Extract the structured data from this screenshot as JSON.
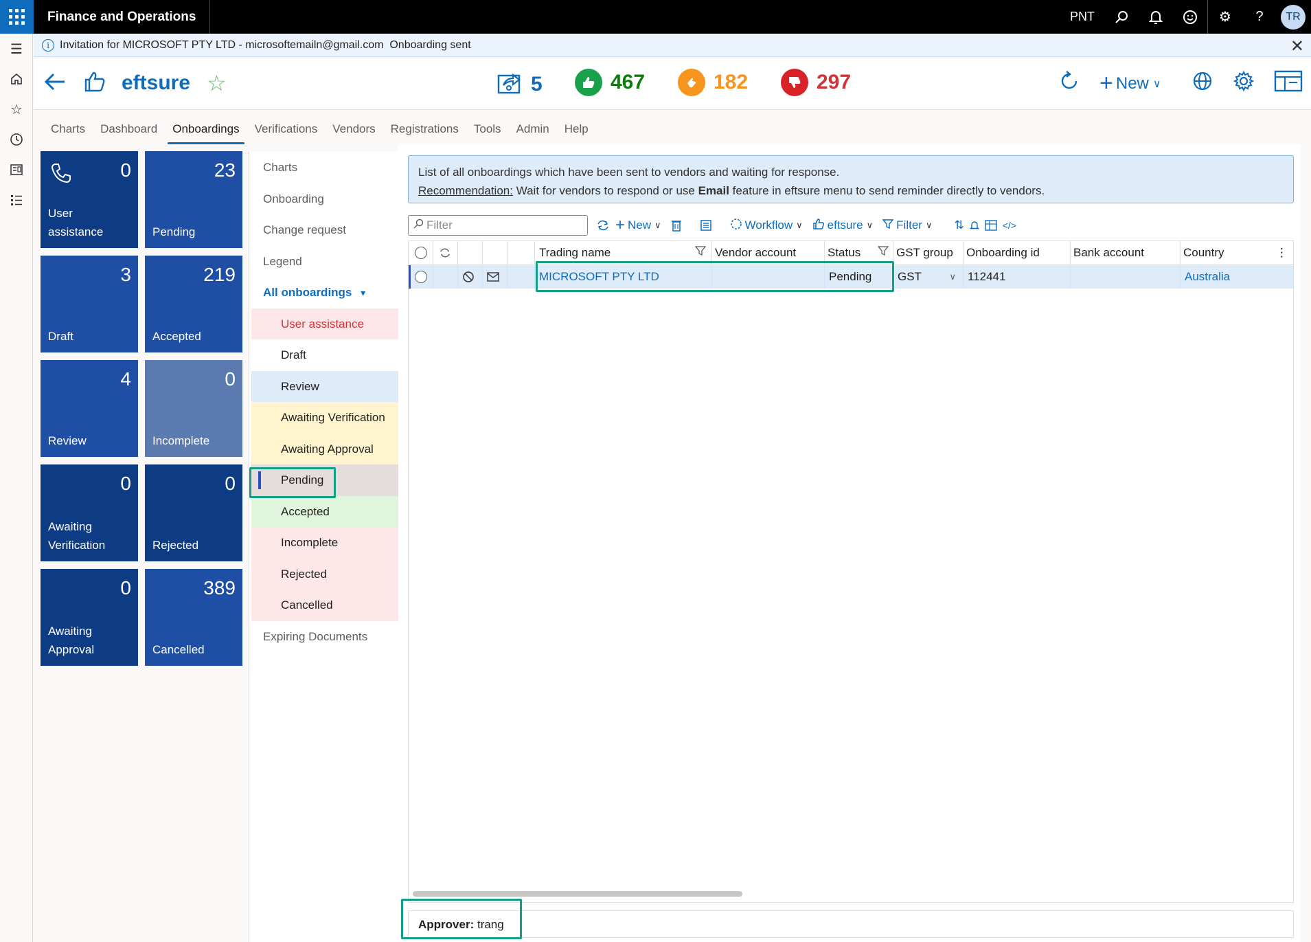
{
  "app": {
    "title": "Finance and Operations",
    "company": "PNT",
    "user_initials": "TR"
  },
  "message_bar": {
    "text": "Invitation for MICROSOFT PTY LTD - microsoftemailn@gmail.com  Onboarding sent"
  },
  "header": {
    "brand": "eftsure",
    "stats": [
      {
        "value": "5",
        "color": "#0f6cbd"
      },
      {
        "value": "467",
        "color": "#107c10"
      },
      {
        "value": "182",
        "color": "#f7941d"
      },
      {
        "value": "297",
        "color": "#d13438"
      }
    ],
    "new_label": "New"
  },
  "tabs": [
    "Charts",
    "Dashboard",
    "Onboardings",
    "Verifications",
    "Vendors",
    "Registrations",
    "Tools",
    "Admin",
    "Help"
  ],
  "tiles": [
    {
      "value": "0",
      "label": "User assistance"
    },
    {
      "value": "23",
      "label": "Pending"
    },
    {
      "value": "3",
      "label": "Draft"
    },
    {
      "value": "219",
      "label": "Accepted"
    },
    {
      "value": "4",
      "label": "Review"
    },
    {
      "value": "0",
      "label": "Incomplete"
    },
    {
      "value": "0",
      "label": "Awaiting Verification"
    },
    {
      "value": "0",
      "label": "Rejected"
    },
    {
      "value": "0",
      "label": "Awaiting Approval"
    },
    {
      "value": "389",
      "label": "Cancelled"
    }
  ],
  "sidenav": {
    "top": [
      "Charts",
      "Onboarding",
      "Change request",
      "Legend"
    ],
    "all_label": "All onboardings",
    "sub": [
      {
        "label": "User assistance",
        "bg": "#fde7e9",
        "color": "#d13438"
      },
      {
        "label": "Draft",
        "bg": "#ffffff",
        "color": "#201f1e"
      },
      {
        "label": "Review",
        "bg": "#deecf9",
        "color": "#201f1e"
      },
      {
        "label": "Awaiting Verification",
        "bg": "#fff4ce",
        "color": "#201f1e"
      },
      {
        "label": "Awaiting Approval",
        "bg": "#fff4ce",
        "color": "#201f1e"
      },
      {
        "label": "Pending",
        "bg": "#e5dcdc",
        "color": "#201f1e"
      },
      {
        "label": "Accepted",
        "bg": "#dff6dd",
        "color": "#201f1e"
      },
      {
        "label": "Incomplete",
        "bg": "#fde7e9",
        "color": "#201f1e"
      },
      {
        "label": "Rejected",
        "bg": "#fde7e9",
        "color": "#201f1e"
      },
      {
        "label": "Cancelled",
        "bg": "#fde7e9",
        "color": "#201f1e"
      }
    ],
    "bottom": "Expiring Documents"
  },
  "info": {
    "line1": "List of all onboardings which have been sent to vendors and waiting for response.",
    "rec_label": "Recommendation:",
    "rec_text_a": " Wait for vendors to respond or use ",
    "rec_bold": "Email",
    "rec_text_b": " feature in eftsure menu to send reminder directly to vendors."
  },
  "actions": {
    "filter_placeholder": "Filter",
    "new": "New",
    "workflow": "Workflow",
    "eftsure": "eftsure",
    "filter": "Filter"
  },
  "grid": {
    "columns": [
      "Trading name",
      "Vendor account",
      "Status",
      "GST group",
      "Onboarding id",
      "Bank account",
      "Country"
    ],
    "row": {
      "trading_name": "MICROSOFT PTY LTD",
      "vendor_account": "",
      "status": "Pending",
      "gst_group": "GST",
      "onboarding_id": "112441",
      "bank_account": "",
      "country": "Australia"
    }
  },
  "footer": {
    "approver_label": "Approver:",
    "approver_value": "trang"
  }
}
